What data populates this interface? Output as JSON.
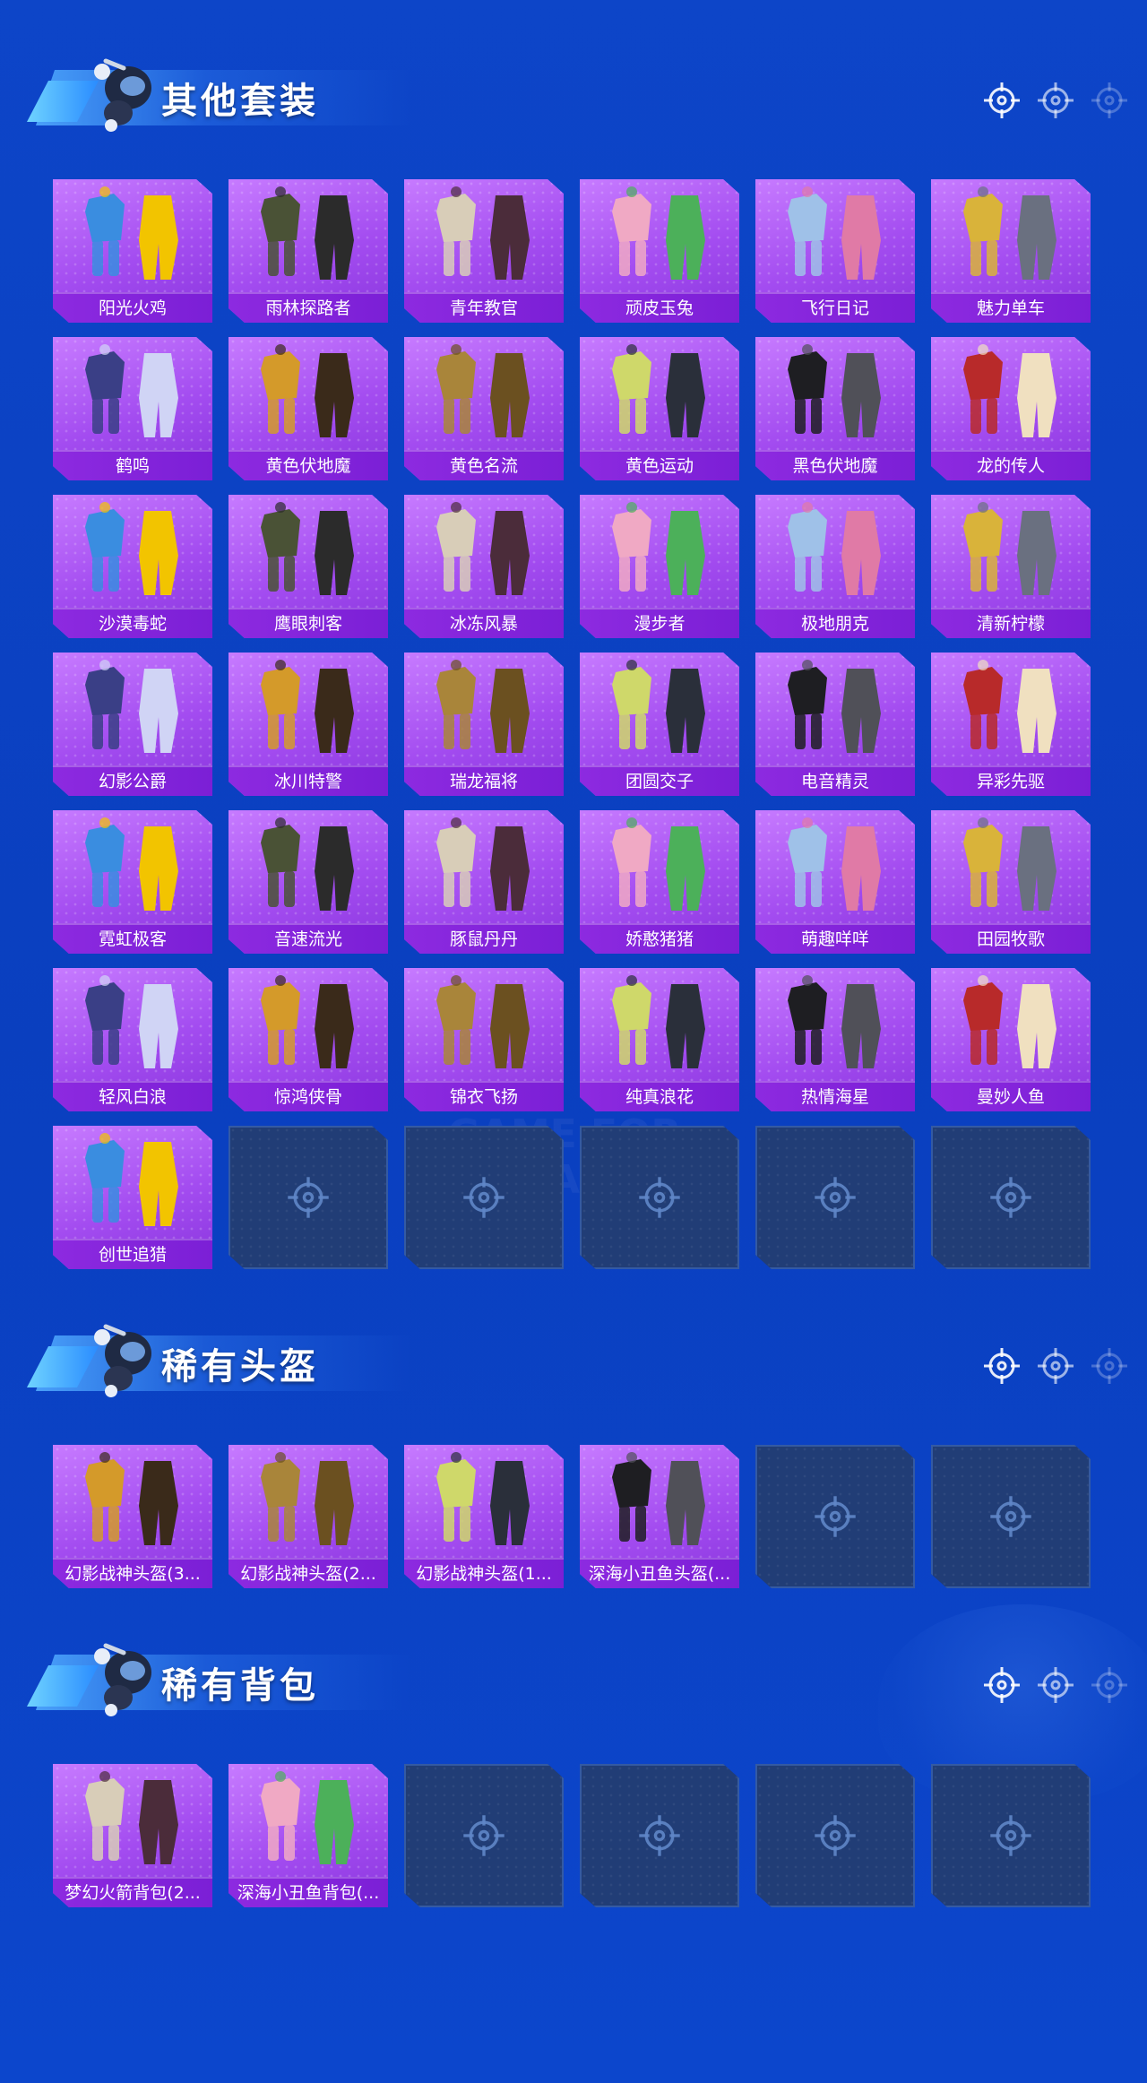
{
  "background": {
    "watermark": "GAME FOR PEACE"
  },
  "colors": {
    "card_bg": "#a34cf0",
    "label_bg": "#8d2ae0",
    "empty_bg": "#213d76",
    "page_bg": "#0d45c8"
  },
  "sections": [
    {
      "title": "其他套装",
      "slots": 42,
      "items": [
        "阳光火鸡",
        "雨林探路者",
        "青年教官",
        "顽皮玉兔",
        "飞行日记",
        "魅力单车",
        "鹤鸣",
        "黄色伏地魔",
        "黄色名流",
        "黄色运动",
        "黑色伏地魔",
        "龙的传人",
        "沙漠毒蛇",
        "鹰眼刺客",
        "冰冻风暴",
        "漫步者",
        "极地朋克",
        "清新柠檬",
        "幻影公爵",
        "冰川特警",
        "瑞龙福将",
        "团圆交子",
        "电音精灵",
        "异彩先驱",
        "霓虹极客",
        "音速流光",
        "豚鼠丹丹",
        "娇憨猪猪",
        "萌趣咩咩",
        "田园牧歌",
        "轻风白浪",
        "惊鸿侠骨",
        "锦衣飞扬",
        "纯真浪花",
        "热情海星",
        "曼妙人鱼",
        "创世追猎"
      ]
    },
    {
      "title": "稀有头盔",
      "slots": 6,
      "items": [
        "幻影战神头盔(3...",
        "幻影战神头盔(2...",
        "幻影战神头盔(1...",
        "深海小丑鱼头盔(..."
      ]
    },
    {
      "title": "稀有背包",
      "slots": 6,
      "items": [
        "梦幻火箭背包(2...",
        "深海小丑鱼背包(..."
      ]
    }
  ]
}
